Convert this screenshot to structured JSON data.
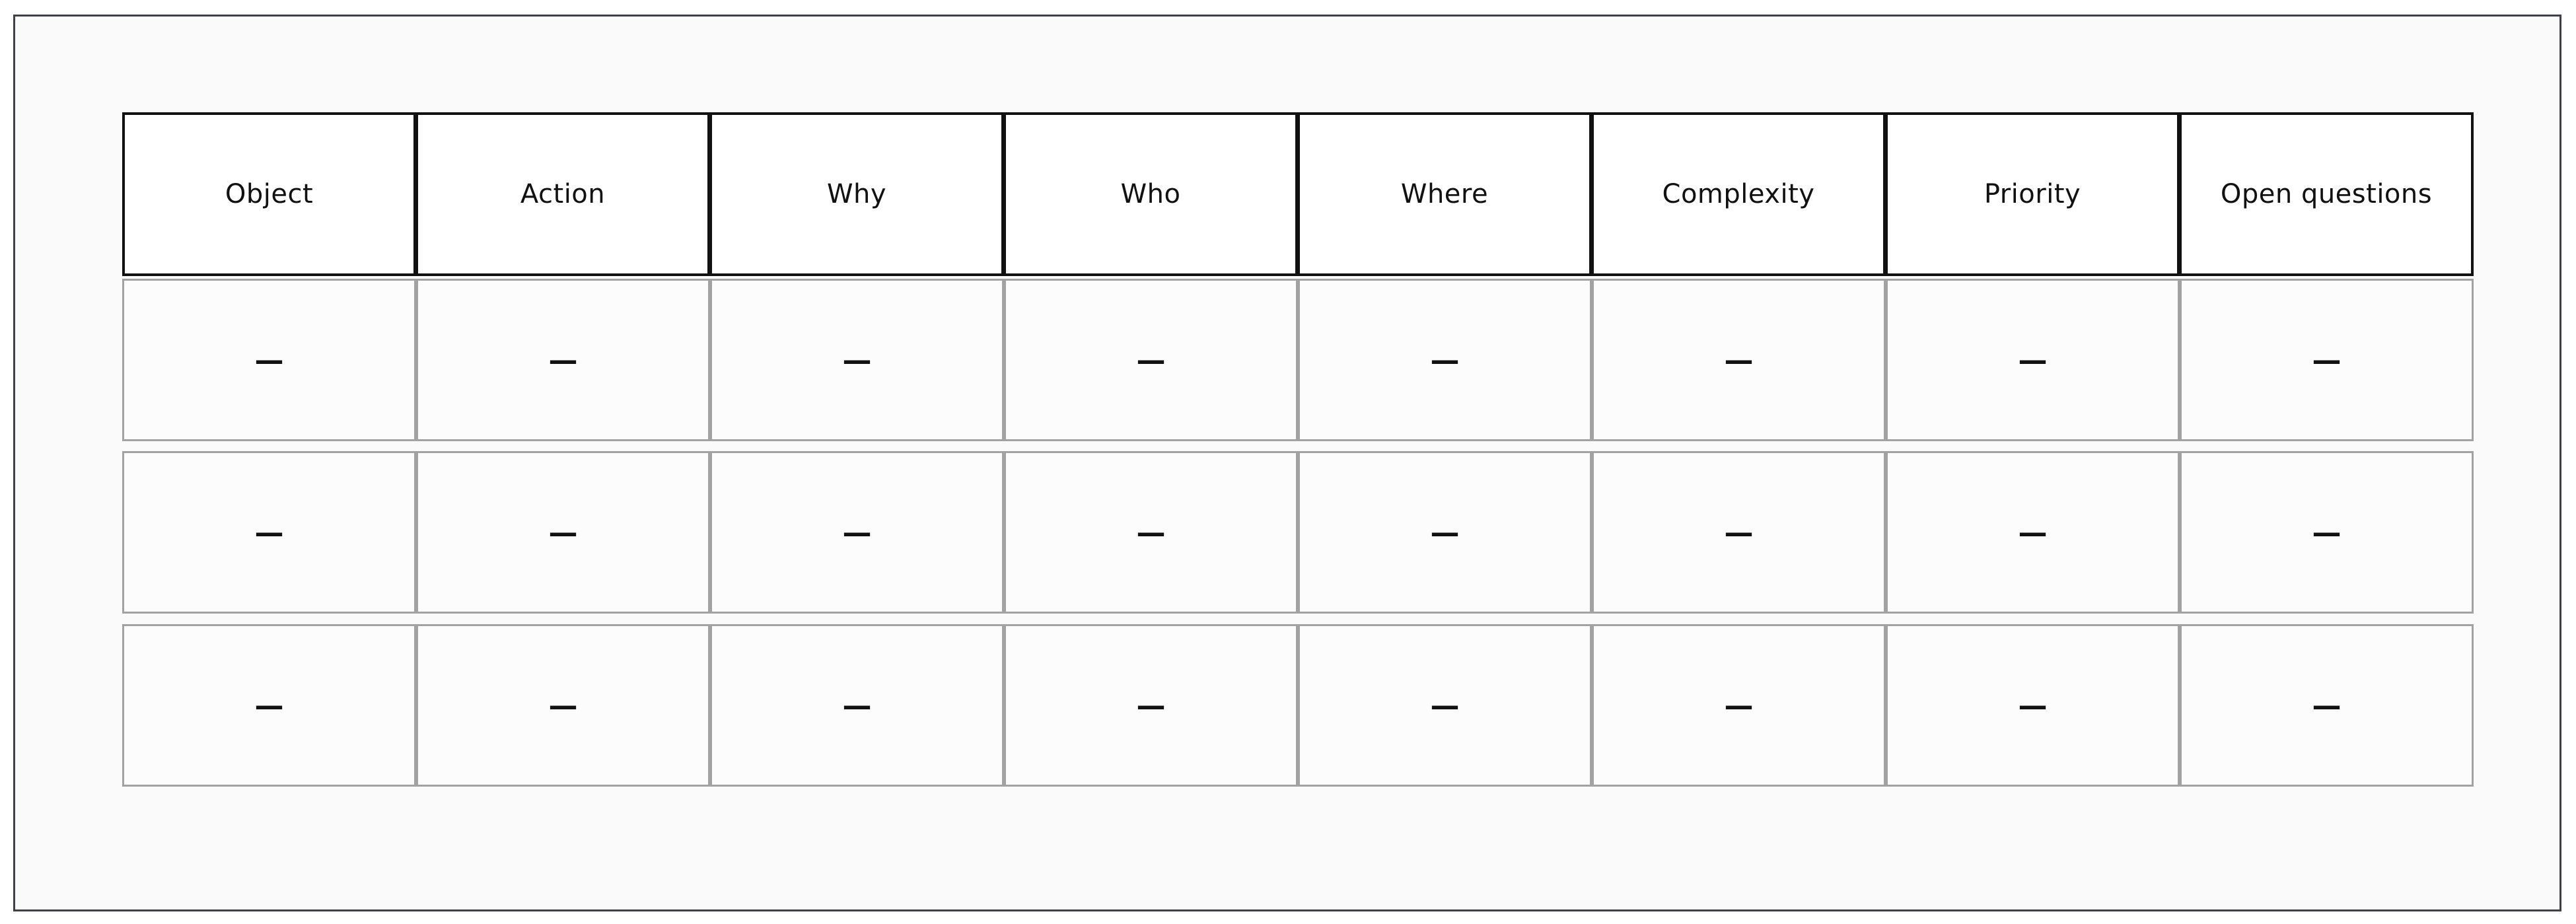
{
  "table": {
    "headers": [
      "Object",
      "Action",
      "Why",
      "Who",
      "Where",
      "Complexity",
      "Priority",
      "Open questions"
    ],
    "rows": [
      [
        "—",
        "—",
        "—",
        "—",
        "—",
        "—",
        "—",
        "—"
      ],
      [
        "—",
        "—",
        "—",
        "—",
        "—",
        "—",
        "—",
        "—"
      ],
      [
        "—",
        "—",
        "—",
        "—",
        "—",
        "—",
        "—",
        "—"
      ]
    ]
  },
  "colors": {
    "frame_border": "#3d4047",
    "frame_background": "#fafafa",
    "header_border": "#111111",
    "cell_border": "#a2a2a2"
  }
}
